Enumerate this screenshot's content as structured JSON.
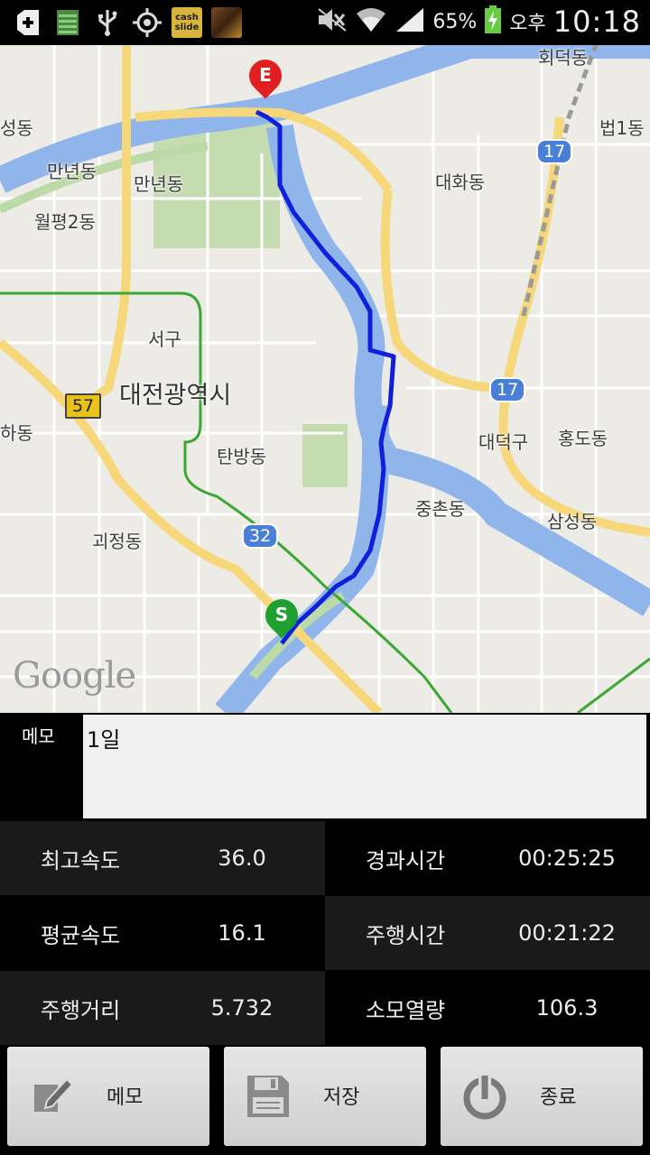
{
  "status_bar": {
    "battery": "65%",
    "ampm": "오후",
    "time": "10:18",
    "cash_slide_label": "cash slide"
  },
  "map": {
    "labels": {
      "hoedeok": "회덕동",
      "beop1": "법1동",
      "seong": "성동",
      "mannyeon1": "만년동",
      "mannyeon2": "만년동",
      "wolpyeong2": "월평2동",
      "daehwa": "대화동",
      "seogu": "서구",
      "city": "대전광역시",
      "ha": "하동",
      "tanbang": "탄방동",
      "daedeokgu": "대덕구",
      "hongdo": "홍도동",
      "jungchon": "중촌동",
      "samseong": "삼성동",
      "goejeong": "괴정동"
    },
    "route_badges": {
      "r17a": "17",
      "r17b": "17",
      "r57": "57",
      "r32": "32"
    },
    "start_marker": "S",
    "end_marker": "E",
    "attribution": "Google"
  },
  "memo": {
    "label": "메모",
    "value": "1일"
  },
  "stats": {
    "max_speed": {
      "label": "최고속도",
      "value": "36.0"
    },
    "elapsed_time": {
      "label": "경과시간",
      "value": "00:25:25"
    },
    "avg_speed": {
      "label": "평균속도",
      "value": "16.1"
    },
    "driving_time": {
      "label": "주행시간",
      "value": "00:21:22"
    },
    "distance": {
      "label": "주행거리",
      "value": "5.732"
    },
    "calories": {
      "label": "소모열량",
      "value": "106.3"
    }
  },
  "buttons": {
    "memo": "메모",
    "save": "저장",
    "exit": "종료"
  }
}
